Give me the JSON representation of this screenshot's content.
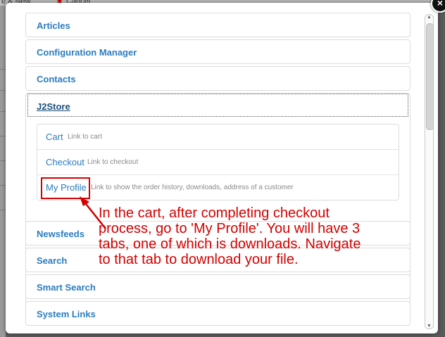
{
  "background": {
    "toolbar": {
      "save_new_label": "e & New",
      "cancel_label": "Cancel"
    }
  },
  "modal": {
    "close_glyph": "×",
    "accordion": [
      {
        "label": "Articles"
      },
      {
        "label": "Configuration Manager"
      },
      {
        "label": "Contacts"
      },
      {
        "label": "J2Store",
        "open": true
      },
      {
        "label": "Newsfeeds"
      },
      {
        "label": "Search"
      },
      {
        "label": "Smart Search"
      },
      {
        "label": "System Links"
      }
    ],
    "j2store_items": [
      {
        "title": "Cart",
        "desc": "Link to cart"
      },
      {
        "title": "Checkout",
        "desc": "Link to checkout"
      },
      {
        "title": "My Profile",
        "desc": "Link to show the order history, downloads, address of a customer"
      }
    ]
  },
  "annotation": {
    "lines": [
      "In the cart, after completing checkout",
      "process, go to 'My Profile'. You will have 3",
      "tabs, one of which is downloads. Navigate",
      "to that tab to download your file."
    ]
  },
  "colors": {
    "link": "#2a7cbf",
    "annotation": "#d40000",
    "border": "#dcdcdc"
  }
}
